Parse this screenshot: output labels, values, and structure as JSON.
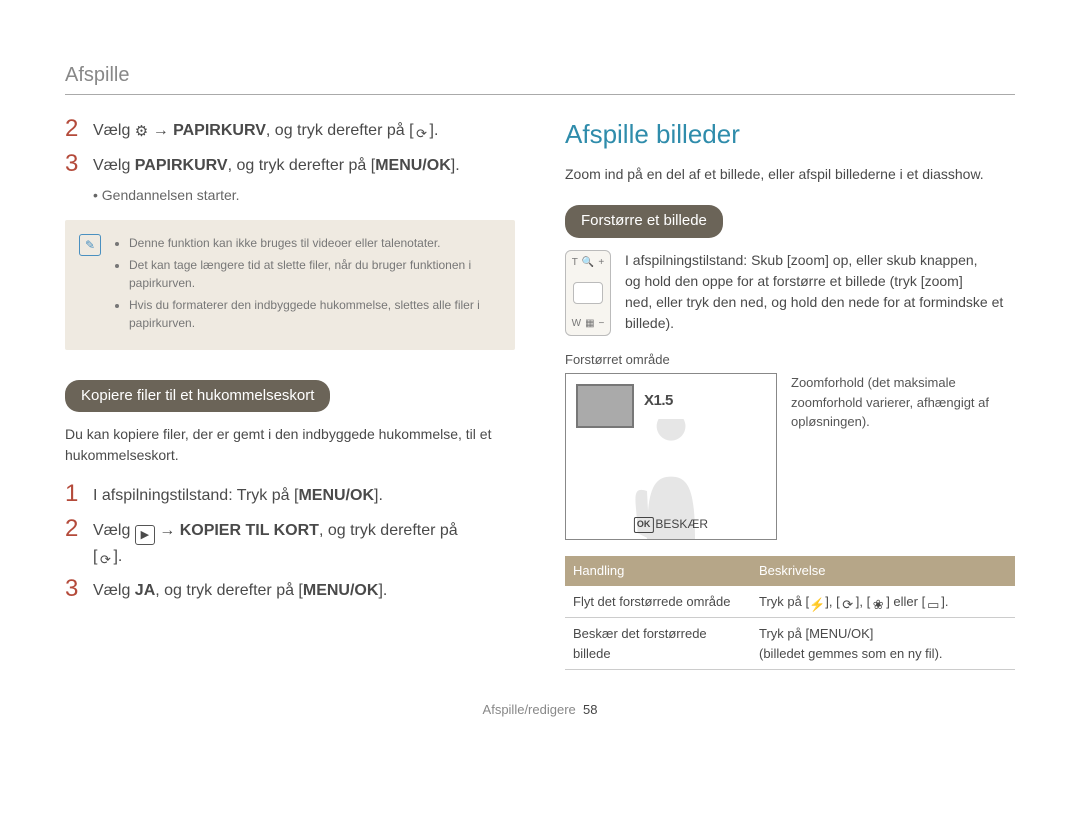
{
  "header": {
    "title": "Afspille"
  },
  "left": {
    "step2": {
      "num": "2",
      "pre": "Vælg ",
      "bold": "PAPIRKURV",
      "post": ", og tryk derefter på ["
    },
    "step3": {
      "num": "3",
      "pre": "Vælg ",
      "bold": "PAPIRKURV",
      "post": ", og tryk derefter på [",
      "menu": "MENU/OK",
      "end": "]."
    },
    "sub_restore": "Gendannelsen starter.",
    "note": {
      "items": [
        "Denne funktion kan ikke bruges til videoer eller talenotater.",
        "Det kan tage længere tid at slette filer, når du bruger funktionen i papirkurven.",
        "Hvis du formaterer den indbyggede hukommelse, slettes alle filer i papirkurven."
      ]
    },
    "pill_copy": "Kopiere filer til et hukommelseskort",
    "copy_intro": "Du kan kopiere filer, der er gemt i den indbyggede hukommelse, til et hukommelseskort.",
    "cstep1": {
      "num": "1",
      "text": "I afspilningstilstand: Tryk på [",
      "menu": "MENU/OK",
      "end": "]."
    },
    "cstep2": {
      "num": "2",
      "pre": "Vælg ",
      "bold": "KOPIER TIL KORT",
      "post": ", og tryk derefter på"
    },
    "cstep3": {
      "num": "3",
      "pre": "Vælg ",
      "bold": "JA",
      "post": ", og tryk derefter på [",
      "menu": "MENU/OK",
      "end": "]."
    }
  },
  "right": {
    "heading": "Afspille billeder",
    "lead": "Zoom ind på en del af et billede, eller afspil billederne i et diasshow.",
    "pill_enlarge": "Forstørre et billede",
    "zoom_desc": {
      "l1_pre": "I afspilningstilstand: Skub [",
      "l1_zoom": "zoom",
      "l1_post": "] op, eller skub knappen,",
      "l2_pre": "og hold den oppe for at forstørre et billede (tryk [",
      "l2_zoom": "zoom",
      "l2_post": "]",
      "l3": "ned, eller tryk den ned, og hold den nede for at formindske et billede)."
    },
    "enlarged_area_label": "Forstørret område",
    "zoom_value": "X1.5",
    "crop_label": "BESKÆR",
    "zoom_caption": "Zoomforhold (det maksimale zoomforhold varierer, afhængigt af opløsningen).",
    "table": {
      "h1": "Handling",
      "h2": "Beskrivelse",
      "r1c1": "Flyt det forstørrede område",
      "r1c2_pre": "Tryk på [",
      "r1c2_mid": "], [",
      "r1c2_or": " eller [",
      "r1c2_end": "].",
      "r2c1": "Beskær det forstørrede billede",
      "r2c2_pre": "Tryk på [",
      "r2c2_menu": "MENU/OK",
      "r2c2_end": "]",
      "r2c2_sub": "(billedet gemmes som en ny fil)."
    }
  },
  "footer": {
    "section": "Afspille/redigere",
    "page": "58"
  }
}
